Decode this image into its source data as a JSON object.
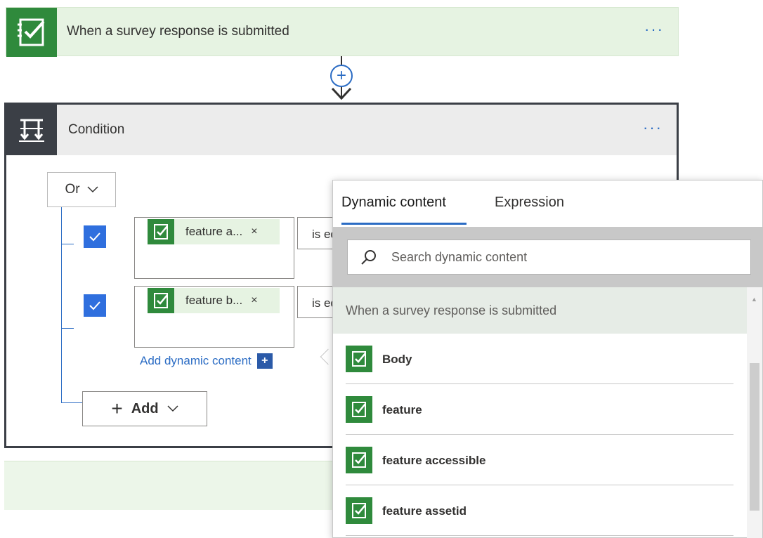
{
  "trigger": {
    "icon": "survey-check-icon",
    "title": "When a survey response is submitted",
    "more": "···"
  },
  "connector": {
    "add_symbol": "+",
    "arrow_icon": "arrow-down-icon"
  },
  "condition": {
    "icon": "condition-icon",
    "title": "Condition",
    "more": "···",
    "group_operator": "Or",
    "rows": [
      {
        "checked": true,
        "token_label": "feature a...",
        "remove": "×",
        "operator": "is equal to"
      },
      {
        "checked": true,
        "token_label": "feature b...",
        "remove": "×",
        "operator": "is equal to"
      }
    ],
    "add_dynamic_content": "Add dynamic content",
    "add_dynamic_symbol": "+",
    "add_plus": "+",
    "add_label": "Add"
  },
  "panel": {
    "tabs": [
      "Dynamic content",
      "Expression"
    ],
    "active_tab": "Dynamic content",
    "search_placeholder": "Search dynamic content",
    "group_title": "When a survey response is submitted",
    "items": [
      {
        "icon": "survey-check-icon",
        "label": "Body"
      },
      {
        "icon": "survey-check-icon",
        "label": "feature"
      },
      {
        "icon": "survey-check-icon",
        "label": "feature accessible"
      },
      {
        "icon": "survey-check-icon",
        "label": "feature assetid"
      }
    ]
  },
  "colors": {
    "trigger_green": "#2f8a3c",
    "trigger_bg": "#e6f3e2",
    "condition_dark": "#3b3f46",
    "accent_blue": "#2b6cc4",
    "checkbox_blue": "#2f6fde"
  }
}
